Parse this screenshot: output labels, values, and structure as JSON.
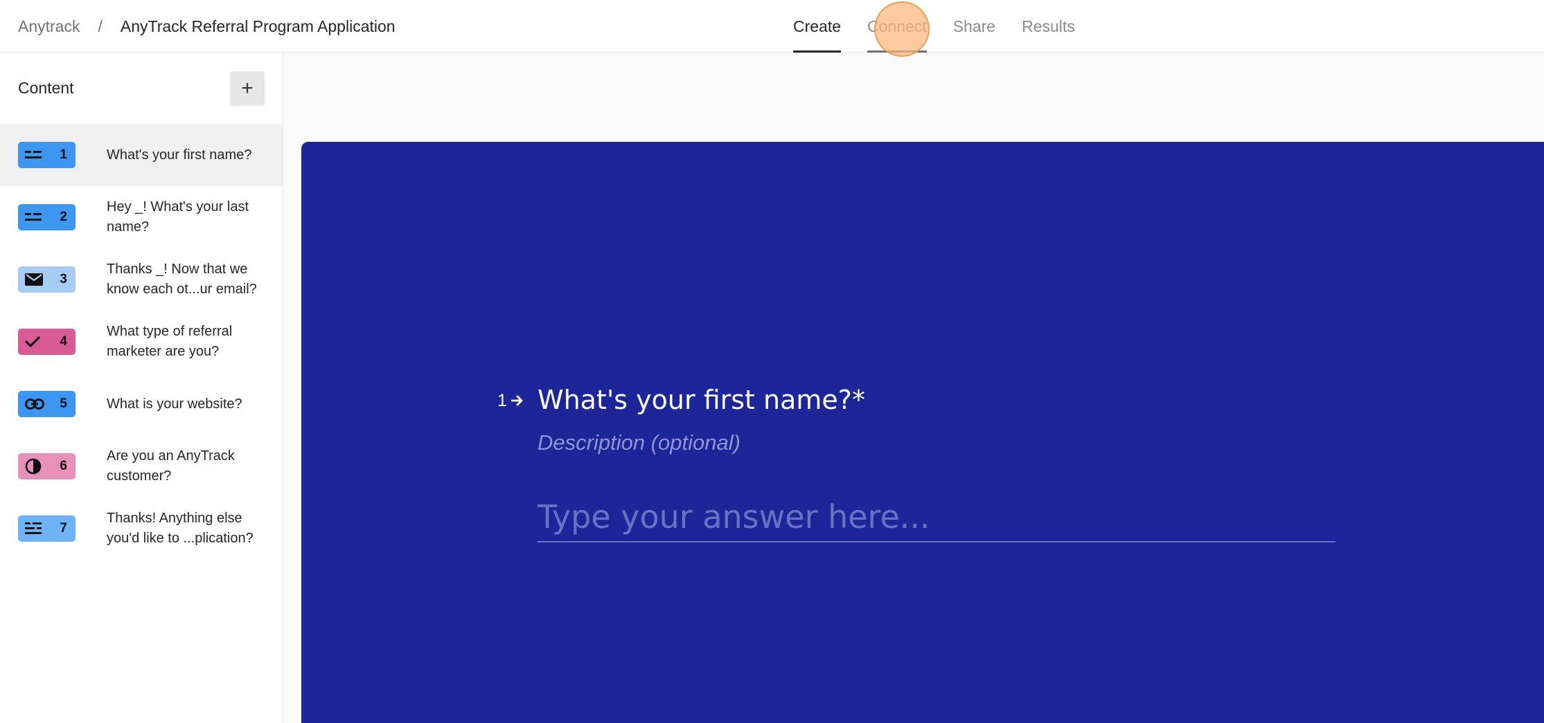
{
  "breadcrumb": {
    "root": "Anytrack",
    "separator": "/",
    "title": "AnyTrack Referral Program Application"
  },
  "tabs": [
    {
      "label": "Create",
      "state": "active"
    },
    {
      "label": "Connect",
      "state": "hover"
    },
    {
      "label": "Share",
      "state": "normal"
    },
    {
      "label": "Results",
      "state": "normal"
    }
  ],
  "sidebar": {
    "title": "Content",
    "add_label": "+",
    "items": [
      {
        "number": "1",
        "label": "What's your first name?",
        "icon": "short-text-icon",
        "color": "#3d97f0"
      },
      {
        "number": "2",
        "label": "Hey _! What's your last name?",
        "icon": "short-text-icon",
        "color": "#3d97f0"
      },
      {
        "number": "3",
        "label": "Thanks _! Now that we know each ot...ur email?",
        "icon": "email-icon",
        "color": "#a7ccf4"
      },
      {
        "number": "4",
        "label": "What type of referral marketer are you?",
        "icon": "checkmark-icon",
        "color": "#d85b95"
      },
      {
        "number": "5",
        "label": "What is your website?",
        "icon": "link-icon",
        "color": "#3d97f0"
      },
      {
        "number": "6",
        "label": "Are you an AnyTrack customer?",
        "icon": "yes-no-icon",
        "color": "#e790b9"
      },
      {
        "number": "7",
        "label": "Thanks! Anything else you'd like to ...plication?",
        "icon": "long-text-icon",
        "color": "#6db3f5"
      }
    ]
  },
  "form": {
    "background": "#1c2699",
    "question_number": "1",
    "question_title": "What's your first name?*",
    "description_placeholder": "Description (optional)",
    "answer_placeholder": "Type your answer here..."
  }
}
